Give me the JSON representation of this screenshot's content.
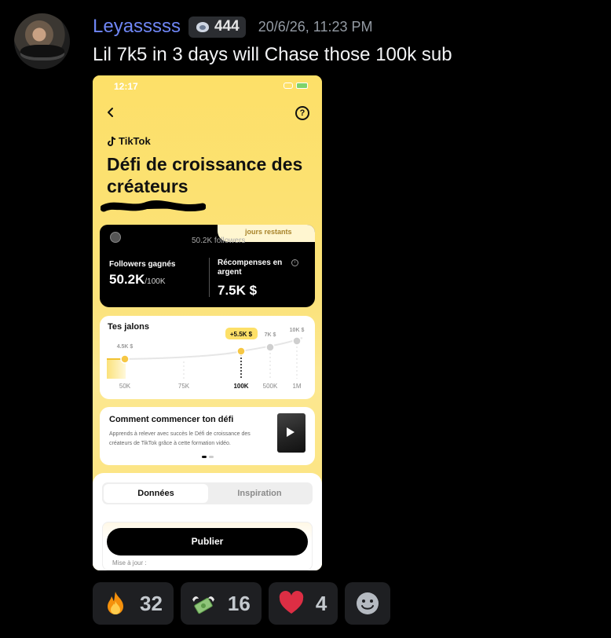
{
  "message": {
    "username": "Leyasssss",
    "role_count": "444",
    "timestamp": "20/6/26, 11:23 PM",
    "text": "Lil 7k5 in 3 days will Chase those 100k sub",
    "username_color": "#6f86f5",
    "avatar_icon": "user-avatar"
  },
  "phone": {
    "status_time": "12:17",
    "brand": "TikTok",
    "title": "Défi de croissance des créateurs",
    "days_remaining": "jours restants",
    "followers_small": "50.2K followers",
    "followers_gained_label": "Followers gagnés",
    "followers_gained_value": "50.2K",
    "followers_goal": "/100K",
    "rewards_label": "Récompenses en argent",
    "rewards_value": "7.5K $",
    "milestones_title": "Tes jalons",
    "milestones": {
      "current_badge": "+5.5K $",
      "reward_labels": [
        "4.5K $",
        "7K $",
        "10K $"
      ],
      "axis_labels": [
        "50K",
        "75K",
        "100K",
        "500K",
        "1M"
      ],
      "highlight_label": "100K"
    },
    "course_title": "Comment commencer ton défi",
    "course_desc": "Apprends à relever avec succès le Défi de croissance des créateurs de TikTok grâce à cette formation vidéo.",
    "tab_active": "Données",
    "tab_inactive": "Inspiration",
    "publish_label": "Publier",
    "updated_label": "Mise à jour :",
    "accent": "#fde068"
  },
  "reactions": [
    {
      "emoji": "fire-emoji",
      "count": "32"
    },
    {
      "emoji": "money-with-wings-emoji",
      "count": "16"
    },
    {
      "emoji": "red-heart-emoji",
      "count": "4"
    }
  ],
  "add_reaction_icon": "add-reaction-icon"
}
